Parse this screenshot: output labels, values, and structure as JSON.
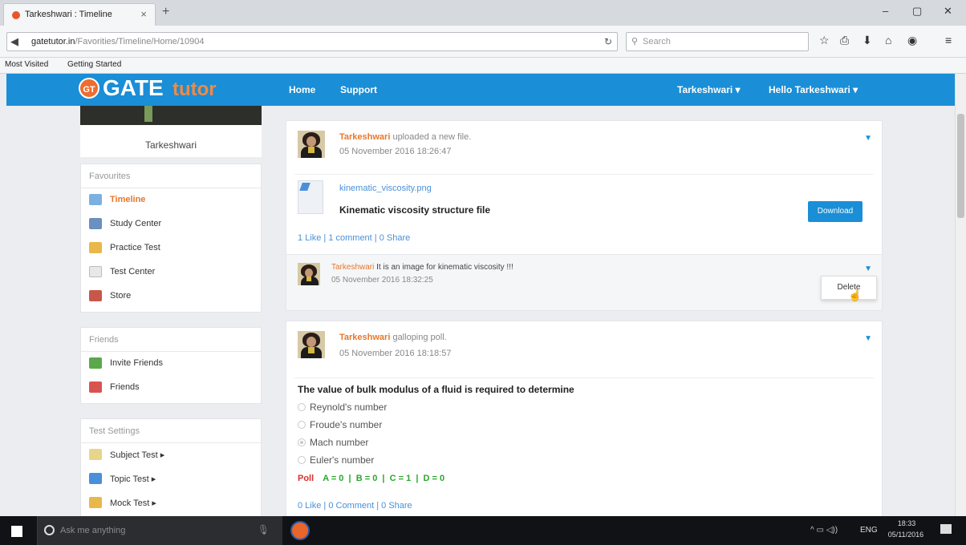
{
  "browser": {
    "tab_title": "Tarkeshwari : Timeline",
    "tab_close": "×",
    "new_tab": "+",
    "url_domain": "gatetutor.in",
    "url_path": "/Favorities/Timeline/Home/10904",
    "search_placeholder": "Search",
    "bookmarks": [
      "Most Visited",
      "Getting Started"
    ],
    "window_controls": [
      "–",
      "▢",
      "✕"
    ],
    "toolbar_icons": [
      "☆",
      "⎙",
      "⬇",
      "⌂",
      "◉",
      "≡"
    ]
  },
  "site": {
    "logo_badge": "GT",
    "logo_gate": "GATE",
    "logo_tutor": "tutor",
    "nav": {
      "home": "Home",
      "support": "Support",
      "user_menu": "Tarkeshwari ▾",
      "hello_menu": "Hello Tarkeshwari ▾"
    }
  },
  "sidebar": {
    "profile_name": "Tarkeshwari",
    "favourites": {
      "heading": "Favourites",
      "items": [
        "Timeline",
        "Study Center",
        "Practice Test",
        "Test Center",
        "Store"
      ]
    },
    "friends": {
      "heading": "Friends",
      "items": [
        "Invite Friends",
        "Friends"
      ]
    },
    "test_settings": {
      "heading": "Test Settings",
      "items": [
        "Subject Test ▸",
        "Topic Test ▸",
        "Mock Test ▸"
      ]
    }
  },
  "feed": {
    "post1": {
      "author": "Tarkeshwari",
      "action": " uploaded a new file.",
      "date": "05 November 2016 18:26:47",
      "file_name": "kinematic_viscosity.png",
      "file_desc": "Kinematic viscosity structure file",
      "download_label": "Download",
      "stats": "1 Like | 1 comment | 0 Share",
      "comment": {
        "author": "Tarkeshwari",
        "text": " It is an image for kinematic viscosity !!!",
        "date": "05 November 2016 18:32:25",
        "delete_label": "Delete"
      }
    },
    "post2": {
      "author": "Tarkeshwari",
      "action": " galloping poll.",
      "date": "05 November 2016 18:18:57",
      "question": "The value of bulk modulus of a fluid is required to determine",
      "options": [
        "Reynold's number",
        "Froude's number",
        "Mach number",
        "Euler's number"
      ],
      "poll_label": "Poll",
      "poll_results": "A = 0  |  B = 0  |  C = 1  |  D = 0",
      "stats": "0 Like | 0 Comment | 0 Share"
    }
  },
  "taskbar": {
    "search_placeholder": "Ask me anything",
    "lang": "ENG",
    "time": "18:33",
    "date": "05/11/2016"
  },
  "colors": {
    "brand_blue": "#1a8ed6",
    "brand_orange": "#e8762c"
  }
}
